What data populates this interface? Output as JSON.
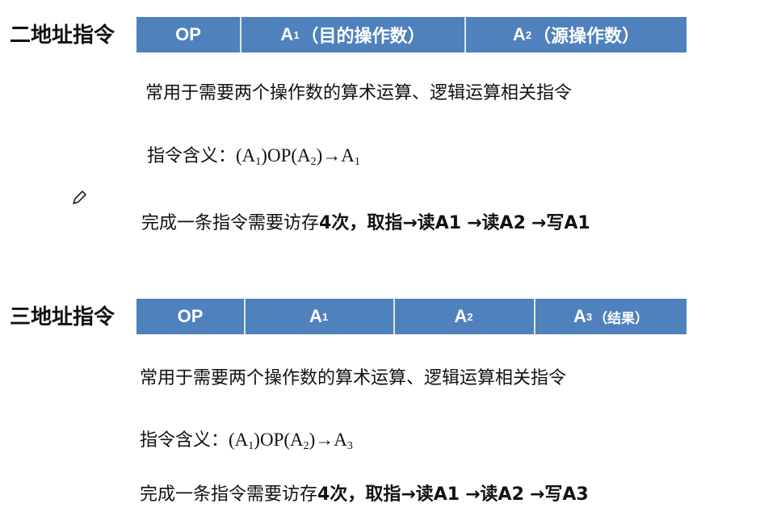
{
  "sections": [
    {
      "label": "二地址指令",
      "cells": [
        {
          "main": "OP",
          "sub": "",
          "note": ""
        },
        {
          "main": "A",
          "sub": "1",
          "note": "（目的操作数）"
        },
        {
          "main": "A",
          "sub": "2",
          "note": "（源操作数）"
        }
      ],
      "usage": "常用于需要两个操作数的算术运算、逻辑运算相关指令",
      "meaning": {
        "label": "指令含义：",
        "p1": "(A",
        "s1": "1",
        "p2": ")OP(A",
        "s2": "2",
        "p3": ")→A",
        "s3": "1"
      },
      "access": {
        "prefix": "完成一条指令需要访存",
        "count": "4次，取指",
        "arrow": "→",
        "r1": "读A1",
        "r2": "读A2",
        "w": "写A1"
      }
    },
    {
      "label": "三地址指令",
      "cells": [
        {
          "main": "OP",
          "sub": "",
          "note": ""
        },
        {
          "main": "A",
          "sub": "1",
          "note": ""
        },
        {
          "main": "A",
          "sub": "2",
          "note": ""
        },
        {
          "main": "A",
          "sub": "3",
          "note": "（结果）"
        }
      ],
      "usage": "常用于需要两个操作数的算术运算、逻辑运算相关指令",
      "meaning": {
        "label": "指令含义：",
        "p1": "(A",
        "s1": "1",
        "p2": ")OP(A",
        "s2": "2",
        "p3": ")→A",
        "s3": "3"
      },
      "access": {
        "prefix": "完成一条指令需要访存",
        "count": "4次，取指",
        "arrow": "→",
        "r1": "读A1",
        "r2": "读A2",
        "w": "写A3"
      }
    }
  ],
  "colors": {
    "bar": "#4f81bd",
    "bar_text": "#ffffff",
    "text": "#111111"
  },
  "icons": {
    "pencil": "pencil-icon"
  }
}
